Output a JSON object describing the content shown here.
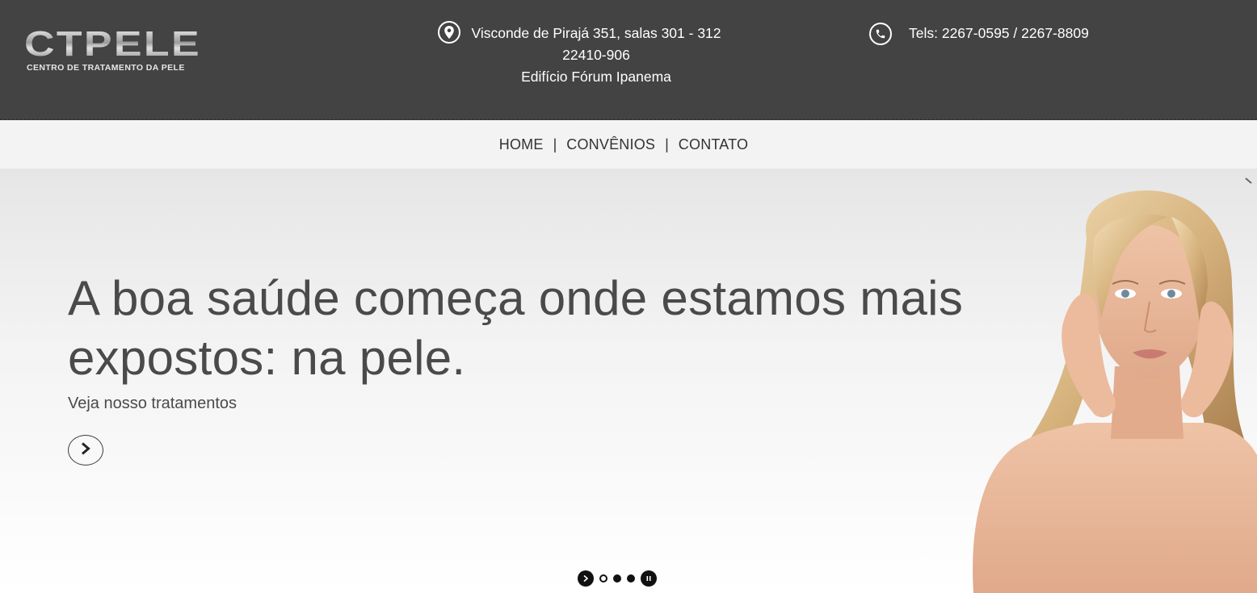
{
  "header": {
    "logo": {
      "mark": "CTPELE",
      "subtitle": "CENTRO DE TRATAMENTO DA PELE"
    },
    "address": {
      "icon": "map-pin-icon",
      "line1": "Visconde de Pirajá 351, salas 301 - 312",
      "line2": "22410-906",
      "line3": "Edifício Fórum Ipanema"
    },
    "phone": {
      "icon": "phone-icon",
      "text": "Tels: 2267-0595 / 2267-8809"
    }
  },
  "nav": {
    "items": [
      {
        "label": "HOME"
      },
      {
        "label": "CONVÊNIOS"
      },
      {
        "label": "CONTATO"
      }
    ],
    "separator": "|"
  },
  "hero": {
    "title": "A boa saúde começa onde estamos mais expostos: na pele.",
    "subtitle": "Veja nosso tratamentos",
    "next_icon": "chevron-right-icon",
    "slider": {
      "slide_count": 3,
      "active_index": 0,
      "play_icon": "play-icon",
      "pause_icon": "pause-icon"
    }
  },
  "colors": {
    "header_bg": "#434343",
    "nav_bg": "#f3f3f3",
    "text_dark": "#4a4a4a",
    "hero_top": "#e6e6e6",
    "hero_bottom": "#ffffff"
  }
}
